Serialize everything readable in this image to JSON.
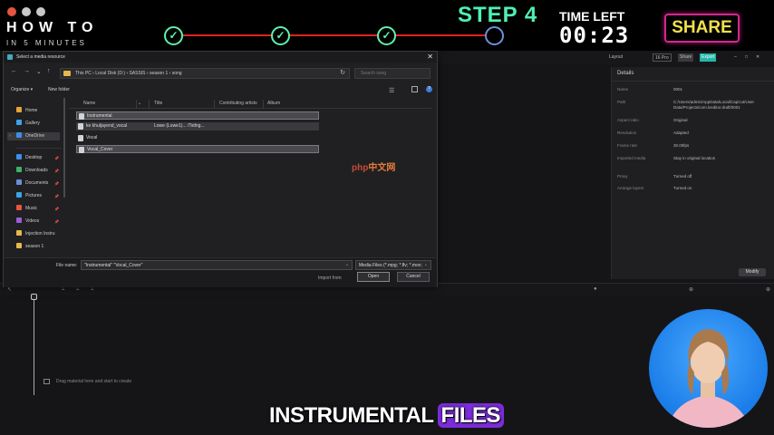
{
  "banner": {
    "howto": "HOW TO",
    "subtitle": "IN 5 MINUTES",
    "step": "STEP 4",
    "time_left_label": "TIME LEFT",
    "timer": "00:23",
    "share": "SHARE",
    "check_glyph": "✓"
  },
  "app_toolbar": {
    "layout": "Layout",
    "ratio": "16 Pro",
    "share": "Share",
    "export": "Export"
  },
  "details": {
    "title": "Details",
    "rows": [
      {
        "label": "Name",
        "value": "0001"
      },
      {
        "label": "Path",
        "value": "C:/Users/admin/AppData/Local/CapCut/User Data/Projects/com.lveditor.draft/0001"
      },
      {
        "label": "Aspect ratio",
        "value": "Original"
      },
      {
        "label": "Resolution",
        "value": "Adapted"
      },
      {
        "label": "Frame rate",
        "value": "30.00fps"
      },
      {
        "label": "Imported media",
        "value": "Stay in original location"
      },
      {
        "label": "Proxy",
        "value": "Turned off"
      },
      {
        "label": "Arrange layers",
        "value": "Turned on"
      }
    ],
    "modify": "Modify"
  },
  "timeline": {
    "drop_text": "Drag material here and start to create"
  },
  "watermark": {
    "brand": "php",
    "cn": "中文网"
  },
  "dialog": {
    "title": "Select a media resource",
    "close": "✕",
    "address_path": "This PC  ›  Local Disk (D:)  ›  SASSIS  ›  season 1  ›  song",
    "search_placeholder": "Search song",
    "organize": "Organize ▾",
    "new_folder": "New folder",
    "nav": [
      {
        "label": "Home",
        "color": "#e8a33a"
      },
      {
        "label": "Gallery",
        "color": "#3fa2e8"
      },
      {
        "label": "OneDrive",
        "color": "#3f8ee8"
      },
      {
        "label": "Desktop",
        "color": "#3f8ee8"
      },
      {
        "label": "Downloads",
        "color": "#3fb06a"
      },
      {
        "label": "Documents",
        "color": "#6a8ed8"
      },
      {
        "label": "Pictures",
        "color": "#3fa2e8"
      },
      {
        "label": "Music",
        "color": "#e8553f"
      },
      {
        "label": "Videos",
        "color": "#9a5fd8"
      },
      {
        "label": "Injection Instru",
        "color": "#e6b94a"
      },
      {
        "label": "season 1",
        "color": "#e6b94a"
      }
    ],
    "columns": {
      "name": "Name",
      "title": "Title",
      "artist": "Contributing artists",
      "album": "Album"
    },
    "files": [
      {
        "name": "Instrumental",
        "title": ""
      },
      {
        "name": "ke khuljayend_vocal",
        "title": "Lowe (Lowe1)... /Tstlng..."
      },
      {
        "name": "Vocal",
        "title": ""
      },
      {
        "name": "Vocal_Cover",
        "title": ""
      }
    ],
    "file_name_label": "File name:",
    "file_name_value": "\"Instrumental\" \"Vocal_Cover\"",
    "file_type": "Media Files (*.mpg; *.flv; *.mov;",
    "import_from": "Import from",
    "open": "Open",
    "cancel": "Cancel"
  },
  "caption": {
    "main": "INSTRUMENTAL",
    "highlight": "FILES"
  },
  "colors": {
    "step_green": "#4ff0b2",
    "progress_red": "#e0221c",
    "share_yellow": "#f1e14a",
    "share_border": "#d02a8c",
    "caption_highlight": "#7b2cdb"
  }
}
